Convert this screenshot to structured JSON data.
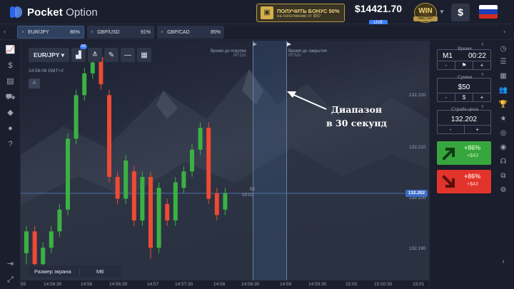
{
  "header": {
    "logo_bold": "Pocket",
    "logo_thin": "Option",
    "bonus_line1": "ПОЛУЧИТЬ БОНУС 50%",
    "bonus_line2": "на пополнение от $50",
    "balance": "$14421.70",
    "balance_mode": "LIVE",
    "status_top": "WIN",
    "status_bottom": "МАСТЕР",
    "cash_icon": "$",
    "flag_colors": [
      "#ffffff",
      "#1c3fb6",
      "#d52b1e"
    ]
  },
  "asset_tabs": [
    {
      "pair": "EUR/JPY",
      "payout": "86%",
      "active": true
    },
    {
      "pair": "GBP/USD",
      "payout": "91%",
      "active": false
    },
    {
      "pair": "GBP/CAD",
      "payout": "85%",
      "active": false
    }
  ],
  "sidebar_icons": [
    "chart-icon",
    "dollar-icon",
    "briefcase-icon",
    "cart-icon",
    "diamond-icon",
    "chat-icon",
    "help-icon",
    "logout-icon",
    "expand-icon"
  ],
  "chart": {
    "pair": "EUR/JPY",
    "timeframe_badge": "5S",
    "clock": "14:58:08 GMT+2",
    "indicator_box": "A",
    "purchase_label": "Время до покупки",
    "purchase_time": "00:22с",
    "close_label": "Время до закрытия",
    "close_time": "00:52с",
    "annotation_line1": "Диапазон",
    "annotation_line2": "в 30 секунд",
    "current_price": "132.202",
    "timer_value": "55",
    "timer_time": "00:02",
    "screen_size_label": "Размер экрана",
    "screen_size_value": "M6",
    "y_ticks": [
      "132.220",
      "132.210",
      "132.200",
      "132.190"
    ],
    "x_ticks": [
      "55",
      "14:56:30",
      "14:56",
      "14:56:30",
      "14:57",
      "14:57:30",
      "14:58",
      "14:58:30",
      "14:59",
      "14:59:30",
      "15:00",
      "15:00:30",
      "15:01"
    ],
    "up_color": "#3bb143",
    "down_color": "#ef4a33"
  },
  "chart_data": {
    "type": "candlestick",
    "series": [
      {
        "values": [
          {
            "o": 132.191,
            "c": 132.195,
            "h": 132.196,
            "l": 132.189
          },
          {
            "o": 132.195,
            "c": 132.189,
            "h": 132.196,
            "l": 132.188
          },
          {
            "o": 132.189,
            "c": 132.192,
            "h": 132.193,
            "l": 132.188
          },
          {
            "o": 132.192,
            "c": 132.195,
            "h": 132.196,
            "l": 132.191
          },
          {
            "o": 132.195,
            "c": 132.199,
            "h": 132.2,
            "l": 132.194
          },
          {
            "o": 132.199,
            "c": 132.212,
            "h": 132.213,
            "l": 132.198
          },
          {
            "o": 132.212,
            "c": 132.22,
            "h": 132.221,
            "l": 132.211
          },
          {
            "o": 132.22,
            "c": 132.224,
            "h": 132.225,
            "l": 132.219
          },
          {
            "o": 132.224,
            "c": 132.226,
            "h": 132.227,
            "l": 132.223
          },
          {
            "o": 132.227,
            "c": 132.222,
            "h": 132.228,
            "l": 132.221
          },
          {
            "o": 132.22,
            "c": 132.205,
            "h": 132.221,
            "l": 132.204
          },
          {
            "o": 132.205,
            "c": 132.201,
            "h": 132.206,
            "l": 132.2
          },
          {
            "o": 132.201,
            "c": 132.208,
            "h": 132.209,
            "l": 132.2
          },
          {
            "o": 132.206,
            "c": 132.197,
            "h": 132.207,
            "l": 132.196
          },
          {
            "o": 132.197,
            "c": 132.205,
            "h": 132.206,
            "l": 132.196
          },
          {
            "o": 132.205,
            "c": 132.192,
            "h": 132.206,
            "l": 132.19
          },
          {
            "o": 132.192,
            "c": 132.203,
            "h": 132.204,
            "l": 132.191
          },
          {
            "o": 132.2,
            "c": 132.197,
            "h": 132.201,
            "l": 132.196
          },
          {
            "o": 132.197,
            "c": 132.204,
            "h": 132.205,
            "l": 132.196
          },
          {
            "o": 132.203,
            "c": 132.206,
            "h": 132.207,
            "l": 132.202
          },
          {
            "o": 132.206,
            "c": 132.21,
            "h": 132.211,
            "l": 132.205
          },
          {
            "o": 132.21,
            "c": 132.214,
            "h": 132.215,
            "l": 132.209
          },
          {
            "o": 132.214,
            "c": 132.201,
            "h": 132.215,
            "l": 132.2
          },
          {
            "o": 132.202,
            "c": 132.198,
            "h": 132.203,
            "l": 132.197
          },
          {
            "o": 132.199,
            "c": 132.202,
            "h": 132.203,
            "l": 132.198
          }
        ]
      }
    ],
    "ylim": [
      132.186,
      132.23
    ]
  },
  "right_panel": {
    "time_label": "Время",
    "time_prefix": "M1",
    "time_value": "00:22",
    "amount_label": "Сумма",
    "amount_value": "$50",
    "strike_label": "Страйк-цена",
    "strike_value": "132.202",
    "minus": "-",
    "plus": "+",
    "dollar": "$",
    "up_pct": "+86%",
    "up_profit": "+$43",
    "down_pct": "+86%",
    "down_profit": "+$43"
  }
}
